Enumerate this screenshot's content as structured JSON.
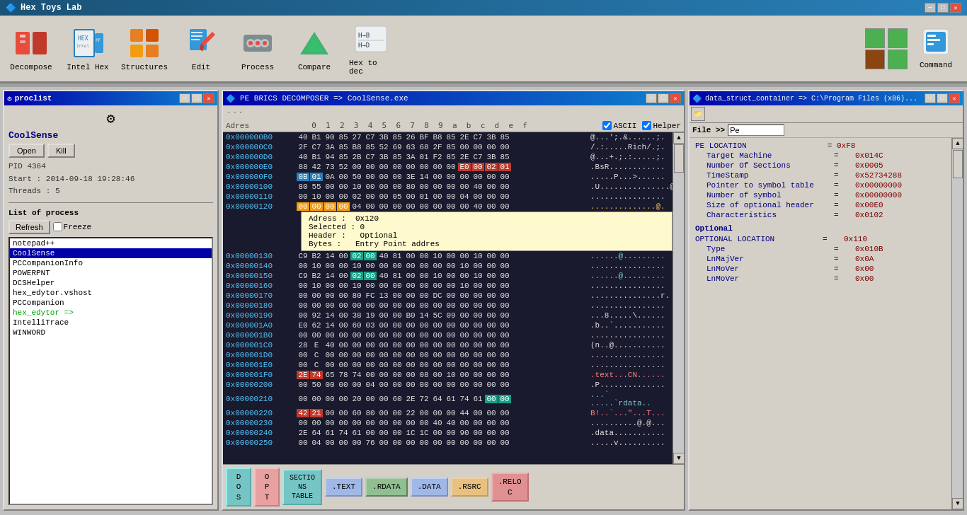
{
  "app": {
    "title": "Hex Toys Lab",
    "icon": "🔷"
  },
  "toolbar": {
    "buttons": [
      {
        "id": "decompose",
        "label": "Decompose",
        "icon": "🧩",
        "color": "#e74c3c"
      },
      {
        "id": "intelhex",
        "label": "Intel Hex",
        "icon": "📄"
      },
      {
        "id": "structures",
        "label": "Structures",
        "icon": "🔶"
      },
      {
        "id": "edit",
        "label": "Edit",
        "icon": "✏️"
      },
      {
        "id": "process",
        "label": "Process",
        "icon": "⚙️"
      },
      {
        "id": "compare",
        "label": "Compare",
        "icon": "🔺"
      },
      {
        "id": "hextodec",
        "label": "Hex to dec",
        "icon": "H→B\nH→D"
      }
    ],
    "right_buttons": [
      {
        "id": "rt1",
        "icon": "🟩"
      },
      {
        "id": "rt2",
        "icon": "🟫"
      },
      {
        "id": "rt3",
        "icon": "🟩"
      },
      {
        "id": "rt4",
        "icon": "🟩"
      }
    ],
    "command_label": "Command"
  },
  "proclist": {
    "title": "proclist",
    "icon": "⚙",
    "proc_name": "CoolSense",
    "open_label": "Open",
    "kill_label": "Kill",
    "pid": "PID 4364",
    "start": "Start : 2014-09-18 19:28:46",
    "threads": "Threads : 5",
    "list_label": "List of process",
    "refresh_label": "Refresh",
    "freeze_label": "Freeze",
    "processes": [
      "notepad++",
      "CoolSense",
      "PCCompanionInfo",
      "POWERPNT",
      "DCSHelper",
      "hex_edytor.vshost",
      "PCCompanion",
      "hex_edytor =>",
      "IntelliTrace",
      "WINWORD"
    ],
    "selected_process": "CoolSense"
  },
  "hex_panel": {
    "title": "PE BRICS DECOMPOSER => CoolSense.exe",
    "col_headers": [
      "0",
      "1",
      "2",
      "3",
      "4",
      "5",
      "6",
      "7",
      "8",
      "9",
      "a",
      "b",
      "c",
      "d",
      "e",
      "f"
    ],
    "ascii_label": "ASCII",
    "helper_label": "Helper",
    "rows": [
      {
        "addr": "0x000000B0",
        "bytes": [
          "40",
          "B1",
          "90",
          "85",
          "27",
          "C7",
          "3B",
          "85",
          "26",
          "BF",
          "B8",
          "85",
          "2E",
          "C7",
          "3B",
          "85"
        ],
        "ascii": "@...';.&......;.",
        "highlights": []
      },
      {
        "addr": "0x000000C0",
        "bytes": [
          "2F",
          "C7",
          "3A",
          "85",
          "B8",
          "85",
          "52",
          "69",
          "63",
          "68",
          "2F",
          "85",
          "00",
          "00",
          "00",
          "00"
        ],
        "ascii": "/.:.....Rich/.;.",
        "highlights": []
      },
      {
        "addr": "0x000000D0",
        "bytes": [
          "40",
          "B1",
          "94",
          "85",
          "2B",
          "C7",
          "3B",
          "85",
          "3A",
          "01",
          "F2",
          "85",
          "2E",
          "C7",
          "3B",
          "85"
        ],
        "ascii": "@...+.;.:.....;.",
        "highlights": []
      },
      {
        "addr": "0x000000E0",
        "bytes": [
          "88",
          "42",
          "73",
          "52",
          "00",
          "00",
          "00",
          "00",
          "00",
          "00",
          "00",
          "00",
          "E0",
          "00",
          "02",
          "01"
        ],
        "ascii": ".BsR............",
        "highlights": [
          {
            "idx": 12,
            "cls": "highlight-red"
          },
          {
            "idx": 13,
            "cls": "highlight-red"
          },
          {
            "idx": 14,
            "cls": "highlight-red"
          },
          {
            "idx": 15,
            "cls": "highlight-red"
          }
        ]
      },
      {
        "addr": "0x000000F0",
        "bytes": [
          "0B",
          "01",
          "0A",
          "00",
          "50",
          "00",
          "00",
          "00",
          "3E",
          "14",
          "00",
          "00",
          "00",
          "00",
          "00",
          "00"
        ],
        "ascii": ".....P...>......",
        "highlights": [
          {
            "idx": 0,
            "cls": "highlight-blue"
          },
          {
            "idx": 1,
            "cls": "highlight-blue"
          }
        ]
      },
      {
        "addr": "0x00000100",
        "bytes": [
          "80",
          "55",
          "00",
          "00",
          "10",
          "00",
          "00",
          "00",
          "80",
          "00",
          "00",
          "00",
          "00",
          "40",
          "00",
          "00"
        ],
        "ascii": ".U...............@..",
        "highlights": []
      },
      {
        "addr": "0x00000110",
        "bytes": [
          "00",
          "10",
          "00",
          "00",
          "02",
          "00",
          "00",
          "05",
          "00",
          "01",
          "00",
          "00",
          "04",
          "00",
          "00",
          "00"
        ],
        "ascii": "................",
        "highlights": []
      },
      {
        "addr": "0x00000120",
        "bytes": [
          "00",
          "00",
          "00",
          "00",
          "04",
          "00",
          "00",
          "00",
          "00",
          "00",
          "00",
          "00",
          "00",
          "40",
          "00",
          "00"
        ],
        "ascii": "..............@.",
        "highlights": [
          {
            "idx": 0,
            "cls": "highlight-yellow"
          },
          {
            "idx": 1,
            "cls": "highlight-yellow"
          },
          {
            "idx": 2,
            "cls": "highlight-yellow"
          },
          {
            "idx": 3,
            "cls": "highlight-yellow"
          }
        ]
      },
      {
        "addr": "0x00000130",
        "bytes": [
          "C9",
          "B2",
          "14",
          "00",
          "02",
          "00",
          "40",
          "81",
          "00",
          "00",
          "10",
          "00",
          "00",
          "10",
          "00",
          "00"
        ],
        "ascii": "......@.........",
        "highlights": [
          {
            "idx": 4,
            "cls": "highlight-teal"
          },
          {
            "idx": 5,
            "cls": "highlight-teal"
          }
        ]
      },
      {
        "addr": "0x00000140",
        "bytes": [
          "00",
          "10",
          "00",
          "00",
          "10",
          "00",
          "00",
          "00",
          "00",
          "00",
          "00",
          "00",
          "10",
          "00",
          "00",
          "00"
        ],
        "ascii": "................",
        "highlights": []
      },
      {
        "addr": "0x00000150",
        "bytes": [
          "C9",
          "B2",
          "14",
          "00",
          "02",
          "00",
          "40",
          "81",
          "00",
          "00",
          "10",
          "00",
          "00",
          "10",
          "00",
          "00"
        ],
        "ascii": "......@.........",
        "highlights": [
          {
            "idx": 4,
            "cls": "highlight-teal"
          },
          {
            "idx": 5,
            "cls": "highlight-teal"
          }
        ]
      },
      {
        "addr": "0x00000160",
        "bytes": [
          "00",
          "10",
          "00",
          "00",
          "10",
          "00",
          "00",
          "00",
          "00",
          "00",
          "00",
          "00",
          "10",
          "00",
          "00",
          "00"
        ],
        "ascii": "................",
        "highlights": []
      },
      {
        "addr": "0x00000170",
        "bytes": [
          "00",
          "00",
          "00",
          "00",
          "80",
          "FC",
          "13",
          "00",
          "00",
          "00",
          "DC",
          "00",
          "00",
          "00",
          "00",
          "00"
        ],
        "ascii": "...............r.",
        "highlights": []
      },
      {
        "addr": "0x00000180",
        "bytes": [
          "00",
          "00",
          "00",
          "00",
          "00",
          "00",
          "00",
          "00",
          "00",
          "00",
          "00",
          "00",
          "00",
          "00",
          "00",
          "00"
        ],
        "ascii": "................",
        "highlights": []
      },
      {
        "addr": "0x00000190",
        "bytes": [
          "00",
          "92",
          "14",
          "00",
          "38",
          "19",
          "00",
          "00",
          "B0",
          "14",
          "5C",
          "09",
          "00",
          "00",
          "00",
          "00"
        ],
        "ascii": "...8.....\\......",
        "highlights": []
      },
      {
        "addr": "0x000001A0",
        "bytes": [
          "E0",
          "62",
          "14",
          "00",
          "60",
          "03",
          "00",
          "00",
          "00",
          "00",
          "00",
          "00",
          "00",
          "00",
          "00",
          "00"
        ],
        "ascii": ".b..`...........",
        "highlights": []
      },
      {
        "addr": "0x000001B0",
        "bytes": [
          "00",
          "00",
          "00",
          "00",
          "00",
          "00",
          "00",
          "00",
          "00",
          "00",
          "00",
          "00",
          "00",
          "00",
          "00",
          "00"
        ],
        "ascii": "................",
        "highlights": []
      },
      {
        "addr": "0x000001C0",
        "bytes": [
          "28",
          "E",
          "40",
          "00",
          "00",
          "00",
          "00",
          "00",
          "00",
          "00",
          "00",
          "00",
          "00",
          "00",
          "00",
          "00"
        ],
        "ascii": "(n..@...........",
        "highlights": []
      },
      {
        "addr": "0x000001D0",
        "bytes": [
          "00",
          "C",
          "00",
          "00",
          "00",
          "00",
          "00",
          "00",
          "00",
          "00",
          "00",
          "00",
          "00",
          "00",
          "00",
          "00"
        ],
        "ascii": "................",
        "highlights": []
      },
      {
        "addr": "0x000001E0",
        "bytes": [
          "00",
          "C",
          "00",
          "00",
          "00",
          "00",
          "00",
          "00",
          "00",
          "00",
          "00",
          "00",
          "00",
          "00",
          "00",
          "00"
        ],
        "ascii": "................",
        "highlights": []
      },
      {
        "addr": "0x000001F0",
        "bytes": [
          "2E",
          "74",
          "65",
          "78",
          "74",
          "00",
          "00",
          "00",
          "00",
          "08",
          "00",
          "10",
          "00",
          "00",
          "00",
          "00"
        ],
        "ascii": ".text...CN......",
        "highlights": [
          {
            "idx": 0,
            "cls": "highlight-red"
          },
          {
            "idx": 1,
            "cls": "highlight-red"
          }
        ]
      },
      {
        "addr": "0x00000200",
        "bytes": [
          "00",
          "50",
          "00",
          "00",
          "00",
          "04",
          "00",
          "00",
          "00",
          "00",
          "00",
          "00",
          "00",
          "00",
          "00",
          "00"
        ],
        "ascii": ".P..............",
        "highlights": []
      },
      {
        "addr": "0x00000210",
        "bytes": [
          "00",
          "00",
          "00",
          "00",
          "20",
          "00",
          "00",
          "60",
          "2E",
          "72",
          "64",
          "61",
          "74",
          "61",
          "00",
          "00"
        ],
        "ascii": "...` .....`rdata..",
        "highlights": [
          {
            "idx": 14,
            "cls": "highlight-teal"
          },
          {
            "idx": 15,
            "cls": "highlight-teal"
          }
        ]
      },
      {
        "addr": "0x00000220",
        "bytes": [
          "42",
          "21",
          "00",
          "00",
          "60",
          "80",
          "00",
          "00",
          "22",
          "00",
          "00",
          "00",
          "44",
          "00",
          "00",
          "00"
        ],
        "ascii": "B!..`...\"...T...",
        "highlights": [
          {
            "idx": 0,
            "cls": "highlight-red"
          },
          {
            "idx": 1,
            "cls": "highlight-red"
          }
        ]
      },
      {
        "addr": "0x00000230",
        "bytes": [
          "00",
          "00",
          "00",
          "00",
          "00",
          "00",
          "00",
          "00",
          "00",
          "00",
          "40",
          "40",
          "00",
          "00",
          "00",
          "00"
        ],
        "ascii": "..........@.@...",
        "highlights": []
      },
      {
        "addr": "0x00000240",
        "bytes": [
          "2E",
          "64",
          "61",
          "74",
          "61",
          "00",
          "00",
          "00",
          "1C",
          "1C",
          "00",
          "00",
          "90",
          "00",
          "00",
          "00"
        ],
        "ascii": ".data...........",
        "highlights": []
      },
      {
        "addr": "0x00000250",
        "bytes": [
          "00",
          "04",
          "00",
          "00",
          "00",
          "76",
          "00",
          "00",
          "00",
          "00",
          "00",
          "00",
          "00",
          "00",
          "00",
          "00"
        ],
        "ascii": ".....v..........",
        "highlights": []
      }
    ],
    "tooltip": {
      "visible": true,
      "adress": "0x120",
      "selected": "0",
      "header": "Optional",
      "bytes": "Entry Point addres"
    },
    "sections": [
      {
        "label": "D\nO\nS",
        "style": "teal"
      },
      {
        "label": "O\nP\nT",
        "style": "pink"
      },
      {
        "label": "SECTIO\nNS\nTABLE",
        "style": "teal"
      },
      {
        "label": ".TEXT",
        "style": "blue"
      },
      {
        "label": ".RDATA",
        "style": "green"
      },
      {
        "label": ".DATA",
        "style": "blue"
      },
      {
        "label": ".RSRC",
        "style": "orange"
      },
      {
        "label": ".RELO\nC",
        "style": "red"
      }
    ]
  },
  "datastruct": {
    "title": "data_struct_container => C:\\Program Files (x86)...",
    "file_label": "File >>",
    "file_filter": "Pe",
    "entries_pe": [
      {
        "label": "PE LOCATION",
        "eq": "=",
        "val": "0xF8"
      },
      {
        "label": "Target Machine",
        "eq": "=",
        "val": "0x014C"
      },
      {
        "label": "Number Of Sections",
        "eq": "=",
        "val": "0x0005"
      },
      {
        "label": "TimeStamp",
        "eq": "=",
        "val": "0x52734288"
      },
      {
        "label": "Pointer to symbol table",
        "eq": "=",
        "val": "0x00000000"
      },
      {
        "label": "Number of symbol",
        "eq": "=",
        "val": "0x00000000"
      },
      {
        "label": "Size of optional header",
        "eq": "=",
        "val": "0x00E0"
      },
      {
        "label": "Characteristics",
        "eq": "=",
        "val": "0x0102"
      }
    ],
    "optional_label": "Optional",
    "entries_optional": [
      {
        "label": "OPTIONAL LOCATION",
        "eq": "=",
        "val": "0x110"
      },
      {
        "label": "Type",
        "eq": "=",
        "val": "0x010B"
      },
      {
        "label": "LnMajVer",
        "eq": "=",
        "val": "0x0A"
      },
      {
        "label": "LnMoVer",
        "eq": "=",
        "val": "0x00"
      }
    ]
  }
}
